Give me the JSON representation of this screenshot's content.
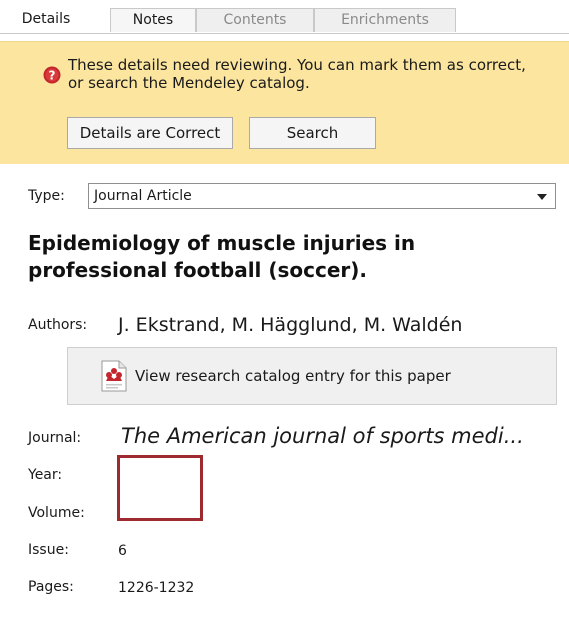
{
  "tabs": [
    "Details",
    "Notes",
    "Contents",
    "Enrichments"
  ],
  "banner": {
    "message": "These details need reviewing. You can mark them as correct,\nor search the Mendeley catalog.",
    "correct_button": "Details are Correct",
    "search_button": "Search",
    "icon": "warning-icon",
    "color": "#fbe59f"
  },
  "fields": {
    "type_label": "Type:",
    "type_value": "Journal Article",
    "title": "Epidemiology of muscle injuries in professional football (soccer).",
    "authors_label": "Authors:",
    "authors_value": "J. Ekstrand, M. Hägglund, M. Waldén",
    "catalog_button": "View research catalog entry for this paper",
    "catalog_icon": "mendeley-document-icon",
    "journal_label": "Journal:",
    "journal_value": "The American journal of sports medi...",
    "year_label": "Year:",
    "year_value": "",
    "volume_label": "Volume:",
    "volume_value": "",
    "issue_label": "Issue:",
    "issue_value": "6",
    "pages_label": "Pages:",
    "pages_value": "1226-1232"
  },
  "colors": {
    "accent_highlight": "#9c2a2e",
    "mendeley_red": "#c4262e"
  }
}
